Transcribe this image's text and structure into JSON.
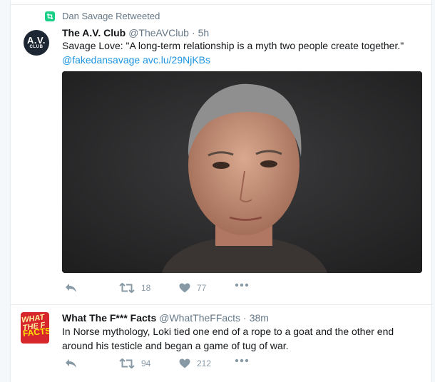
{
  "tweets": [
    {
      "context": "Dan Savage Retweeted",
      "avatar": {
        "main": "A.V.",
        "sub": "CLUB"
      },
      "author": "The A.V. Club",
      "handle": "@TheAVClub",
      "time": "5h",
      "text": "Savage Love: \"A long-term relationship is a myth two people create together.\"",
      "mention": "@fakedansavage",
      "link": "avc.lu/29NjKBs",
      "retweets": "18",
      "likes": "77"
    },
    {
      "avatar": {
        "top": "WHAT THE F",
        "bottom": "FACTS"
      },
      "author": "What The F*** Facts",
      "handle": "@WhatTheFFacts",
      "time": "38m",
      "text": "In Norse mythology, Loki tied one end of a rope to a goat and the other end around his testicle and began a game of tug of war.",
      "retweets": "94",
      "likes": "212"
    }
  ],
  "colors": {
    "link": "#1b95e0",
    "muted": "#657786",
    "icon": "#8899a6",
    "retweet_badge": "#19cf86"
  }
}
